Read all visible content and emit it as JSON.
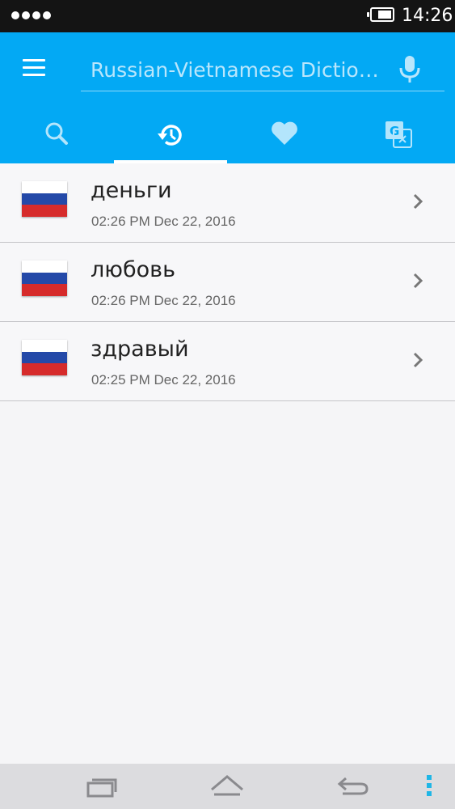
{
  "status_bar": {
    "time": "14:26"
  },
  "header": {
    "search": {
      "placeholder": "Russian-Vietnamese Dictionary"
    },
    "tabs": [
      {
        "name": "search",
        "icon": "search-icon",
        "active": false
      },
      {
        "name": "history",
        "icon": "history-icon",
        "active": true
      },
      {
        "name": "favorites",
        "icon": "heart-icon",
        "active": false
      },
      {
        "name": "translate",
        "icon": "translate-icon",
        "active": false
      }
    ]
  },
  "history": [
    {
      "word": "деньги",
      "timestamp": "02:26 PM Dec 22, 2016"
    },
    {
      "word": "любовь",
      "timestamp": "02:26 PM Dec 22, 2016"
    },
    {
      "word": "здравый",
      "timestamp": "02:25 PM Dec 22, 2016"
    }
  ],
  "colors": {
    "accent": "#03a9f4",
    "status_bar": "#141414",
    "nav_bar": "#dcdcdf"
  }
}
